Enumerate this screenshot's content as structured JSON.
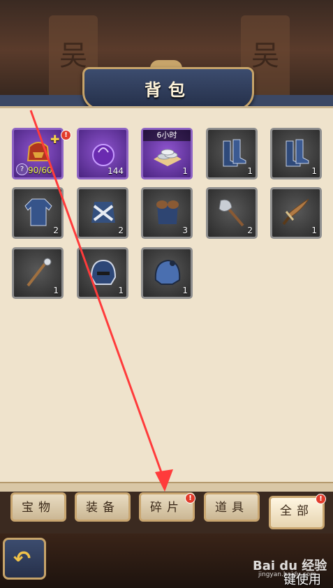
{
  "header": {
    "title": "背包",
    "banner_glyph": "吴"
  },
  "items": [
    {
      "count": "",
      "progress": "90/60",
      "fragment_mark": "?",
      "plus": "✚",
      "alert": "!"
    },
    {
      "count": "144"
    },
    {
      "count": "1",
      "top_label": "6小时"
    },
    {
      "count": "1"
    },
    {
      "count": "1"
    },
    {
      "count": "2"
    },
    {
      "count": "2"
    },
    {
      "count": "3"
    },
    {
      "count": "2"
    },
    {
      "count": "1"
    },
    {
      "count": "1"
    },
    {
      "count": "1"
    },
    {
      "count": "1"
    }
  ],
  "tabs": [
    {
      "label": "宝物"
    },
    {
      "label": "装备"
    },
    {
      "label": "碎片",
      "alert": "!"
    },
    {
      "label": "道具"
    },
    {
      "label": "全部",
      "alert": "!"
    }
  ],
  "watermark": {
    "logo": "Bai du 经验",
    "site": "jingyan.baidu.com",
    "cta": "键使用"
  },
  "colors": {
    "annotation_arrow": "#ff3b3b",
    "purple_frame": "#8e64c4",
    "alert_badge": "#e23b2b"
  }
}
